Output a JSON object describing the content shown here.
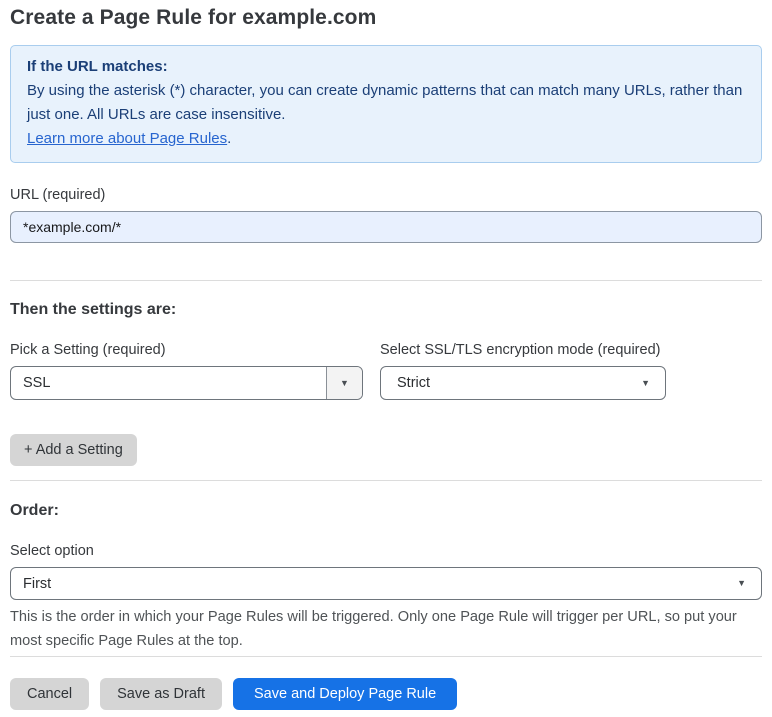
{
  "page": {
    "title": "Create a Page Rule for example.com"
  },
  "info_box": {
    "heading": "If the URL matches:",
    "body": "By using the asterisk (*) character, you can create dynamic patterns that can match many URLs, rather than just one. All URLs are case insensitive.",
    "link_label": "Learn more about Page Rules",
    "link_suffix": "."
  },
  "url_field": {
    "label": "URL (required)",
    "value": "*example.com/*"
  },
  "settings_section": {
    "heading": "Then the settings are:",
    "setting_select": {
      "label": "Pick a Setting (required)",
      "value": "SSL"
    },
    "mode_select": {
      "label": "Select SSL/TLS encryption mode (required)",
      "value": "Strict"
    },
    "add_setting_label": "+ Add a Setting"
  },
  "order_section": {
    "heading": "Order:",
    "select_label": "Select option",
    "select_value": "First",
    "help_text": "This is the order in which your Page Rules will be triggered. Only one Page Rule will trigger per URL, so put your most specific Page Rules at the top."
  },
  "footer": {
    "cancel_label": "Cancel",
    "save_draft_label": "Save as Draft",
    "save_deploy_label": "Save and Deploy Page Rule"
  },
  "icons": {
    "dropdown_arrow": "▼"
  },
  "colors": {
    "info_box_bg": "#e8f2fc",
    "info_box_border": "#a9cdee",
    "info_box_text": "#1b3f77",
    "link_blue": "#2765cf",
    "input_autofill_bg": "#e8f0fe",
    "primary_button_blue": "#1672e6",
    "secondary_button_gray": "#d5d5d5",
    "divider_gray": "#dcdcdc"
  }
}
